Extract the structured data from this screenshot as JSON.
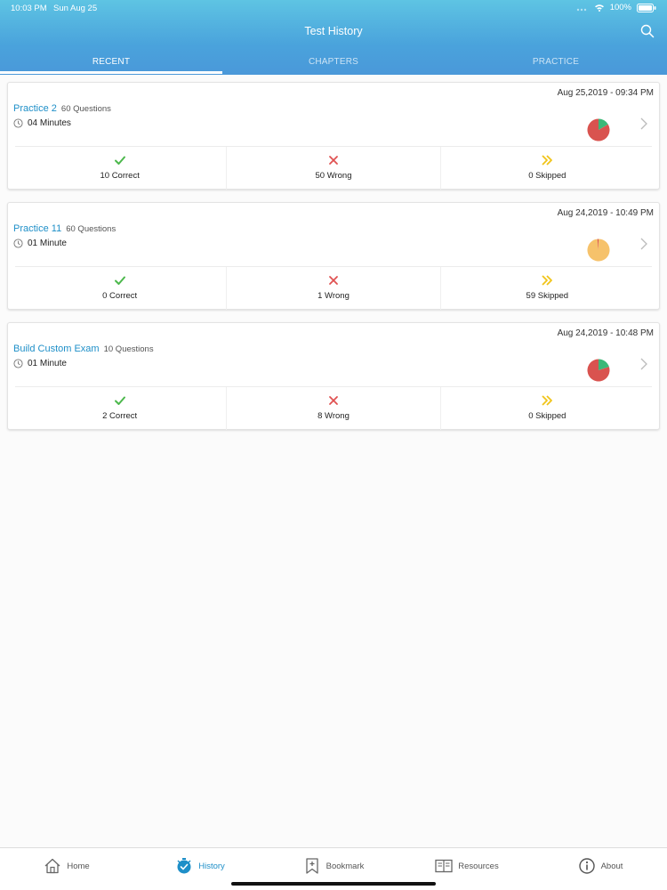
{
  "status": {
    "time": "10:03 PM",
    "date": "Sun Aug 25",
    "battery": "100%"
  },
  "header": {
    "title": "Test History"
  },
  "tabs": [
    {
      "label": "RECENT",
      "active": true
    },
    {
      "label": "CHAPTERS",
      "active": false
    },
    {
      "label": "PRACTICE",
      "active": false
    }
  ],
  "colors": {
    "accent": "#1e8fc8",
    "correct": "#4cb84c",
    "wrong": "#e05252",
    "skipped": "#f0c419",
    "pie_wrong": "#d9534f",
    "pie_correct": "#3cb878",
    "pie_skipped": "#f6c26b"
  },
  "tests": [
    {
      "date": "Aug 25,2019 - 09:34 PM",
      "name": "Practice 2",
      "questions": "60 Questions",
      "duration": "04 Minutes",
      "correct_label": "10 Correct",
      "wrong_label": "50 Wrong",
      "skipped_label": "0 Skipped",
      "correct": 10,
      "wrong": 50,
      "skipped": 0
    },
    {
      "date": "Aug 24,2019 - 10:49 PM",
      "name": "Practice 11",
      "questions": "60 Questions",
      "duration": "01 Minute",
      "correct_label": "0 Correct",
      "wrong_label": "1 Wrong",
      "skipped_label": "59 Skipped",
      "correct": 0,
      "wrong": 1,
      "skipped": 59
    },
    {
      "date": "Aug 24,2019 - 10:48 PM",
      "name": "Build Custom Exam",
      "questions": "10 Questions",
      "duration": "01 Minute",
      "correct_label": "2 Correct",
      "wrong_label": "8 Wrong",
      "skipped_label": "0 Skipped",
      "correct": 2,
      "wrong": 8,
      "skipped": 0
    }
  ],
  "nav": [
    {
      "label": "Home",
      "icon": "home-icon",
      "active": false
    },
    {
      "label": "History",
      "icon": "history-icon",
      "active": true
    },
    {
      "label": "Bookmark",
      "icon": "bookmark-icon",
      "active": false
    },
    {
      "label": "Resources",
      "icon": "resources-icon",
      "active": false
    },
    {
      "label": "About",
      "icon": "info-icon",
      "active": false
    }
  ]
}
